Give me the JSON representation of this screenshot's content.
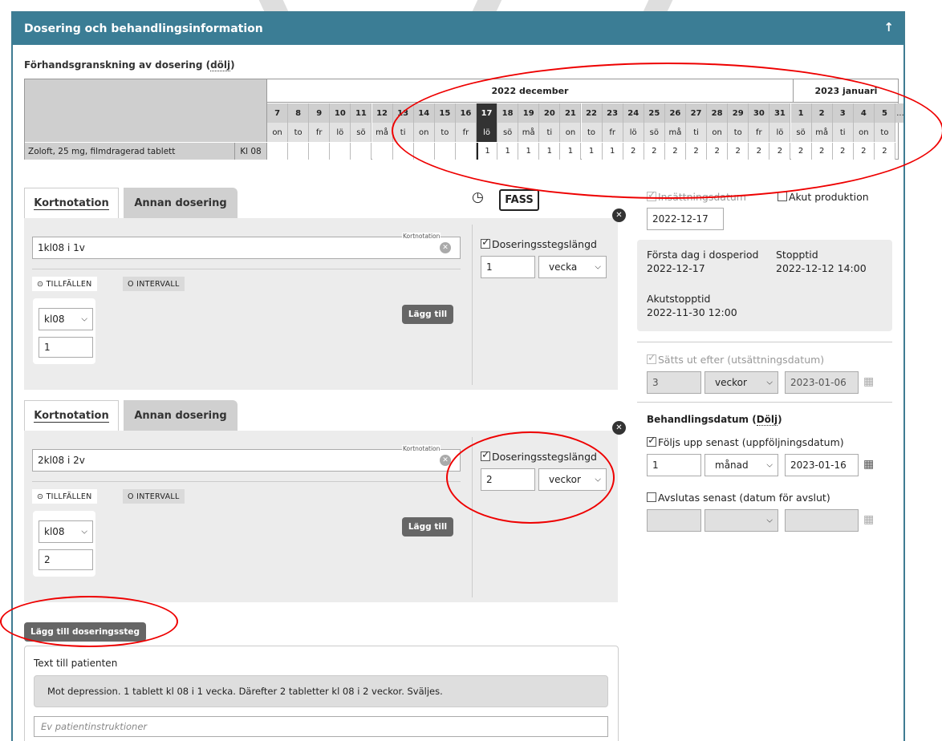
{
  "panel": {
    "title": "Dosering och behandlingsinformation",
    "collapse_icon": "arrow-up-icon"
  },
  "preview": {
    "label": "Förhandsgranskning av dosering (",
    "hide_link": "dölj",
    "label_end": ")"
  },
  "calendar": {
    "months": [
      {
        "name": "2022 december"
      },
      {
        "name": "2023 januari"
      }
    ],
    "days": [
      "7",
      "8",
      "9",
      "10",
      "11",
      "12",
      "13",
      "14",
      "15",
      "16",
      "17",
      "18",
      "19",
      "20",
      "21",
      "22",
      "23",
      "24",
      "25",
      "26",
      "27",
      "28",
      "29",
      "30",
      "31",
      "1",
      "2",
      "3",
      "4",
      "5"
    ],
    "weekdays": [
      "on",
      "to",
      "fr",
      "lö",
      "sö",
      "må",
      "ti",
      "on",
      "to",
      "fr",
      "lö",
      "sö",
      "må",
      "ti",
      "on",
      "to",
      "fr",
      "lö",
      "sö",
      "må",
      "ti",
      "on",
      "to",
      "fr",
      "lö",
      "sö",
      "må",
      "ti",
      "on",
      "to"
    ],
    "doses": [
      "",
      "",
      "",
      "",
      "",
      "",
      "",
      "",
      "",
      "",
      "1",
      "1",
      "1",
      "1",
      "1",
      "1",
      "1",
      "2",
      "2",
      "2",
      "2",
      "2",
      "2",
      "2",
      "2",
      "2",
      "2",
      "2",
      "2",
      "2"
    ],
    "more": "...",
    "drug": "Zoloft, 25 mg, filmdragerad tablett",
    "time": "Kl 08",
    "today_index": 10
  },
  "step1": {
    "tab_active": "Kortnotation",
    "tab_other": "Annan dosering",
    "notation_value": "1kl08 i 1v",
    "notation_tag": "Kortnotation",
    "pill_on": "⊙ TILLFÄLLEN",
    "pill_off": "O INTERVALL",
    "time_select": "kl08",
    "dose_value": "1",
    "add_label": "Lägg till",
    "step_length_label": "Doseringsstegslängd",
    "step_length_value": "1",
    "step_length_unit": "vecka"
  },
  "step2": {
    "tab_active": "Kortnotation",
    "tab_other": "Annan dosering",
    "notation_value": "2kl08 i 2v",
    "notation_tag": "Kortnotation",
    "pill_on": "⊙ TILLFÄLLEN",
    "pill_off": "O INTERVALL",
    "time_select": "kl08",
    "dose_value": "2",
    "add_label": "Lägg till",
    "step_length_label": "Doseringsstegslängd",
    "step_length_value": "2",
    "step_length_unit": "veckor"
  },
  "fass": "FASS",
  "add_step_label": "Lägg till doseringssteg",
  "right": {
    "insattning_label": "Insättningsdatum",
    "akut_label": "Akut produktion",
    "insattning_value": "2022-12-17",
    "first_day_label": "Första dag i dosperiod",
    "first_day_value": "2022-12-17",
    "stop_label": "Stopptid",
    "stop_value": "2022-12-12 14:00",
    "akutstopp_label": "Akutstopptid",
    "akutstopp_value": "2022-11-30 12:00",
    "satts_ut_label": "Sätts ut efter (utsättningsdatum)",
    "satts_ut_num": "3",
    "satts_ut_unit": "veckor",
    "satts_ut_date": "2023-01-06",
    "behandling_label": "Behandlingsdatum (",
    "behandling_link": "Dölj",
    "behandling_end": ")",
    "foljs_label": "Följs upp senast (uppföljningsdatum)",
    "foljs_num": "1",
    "foljs_unit": "månad",
    "foljs_date": "2023-01-16",
    "avslutas_label": "Avslutas senast (datum för avslut)"
  },
  "patient": {
    "title": "Text till patienten",
    "text": "Mot depression. 1 tablett kl 08 i 1 vecka. Därefter 2 tabletter kl 08 i 2 veckor. Sväljes.",
    "placeholder": "Ev patientinstruktioner"
  }
}
